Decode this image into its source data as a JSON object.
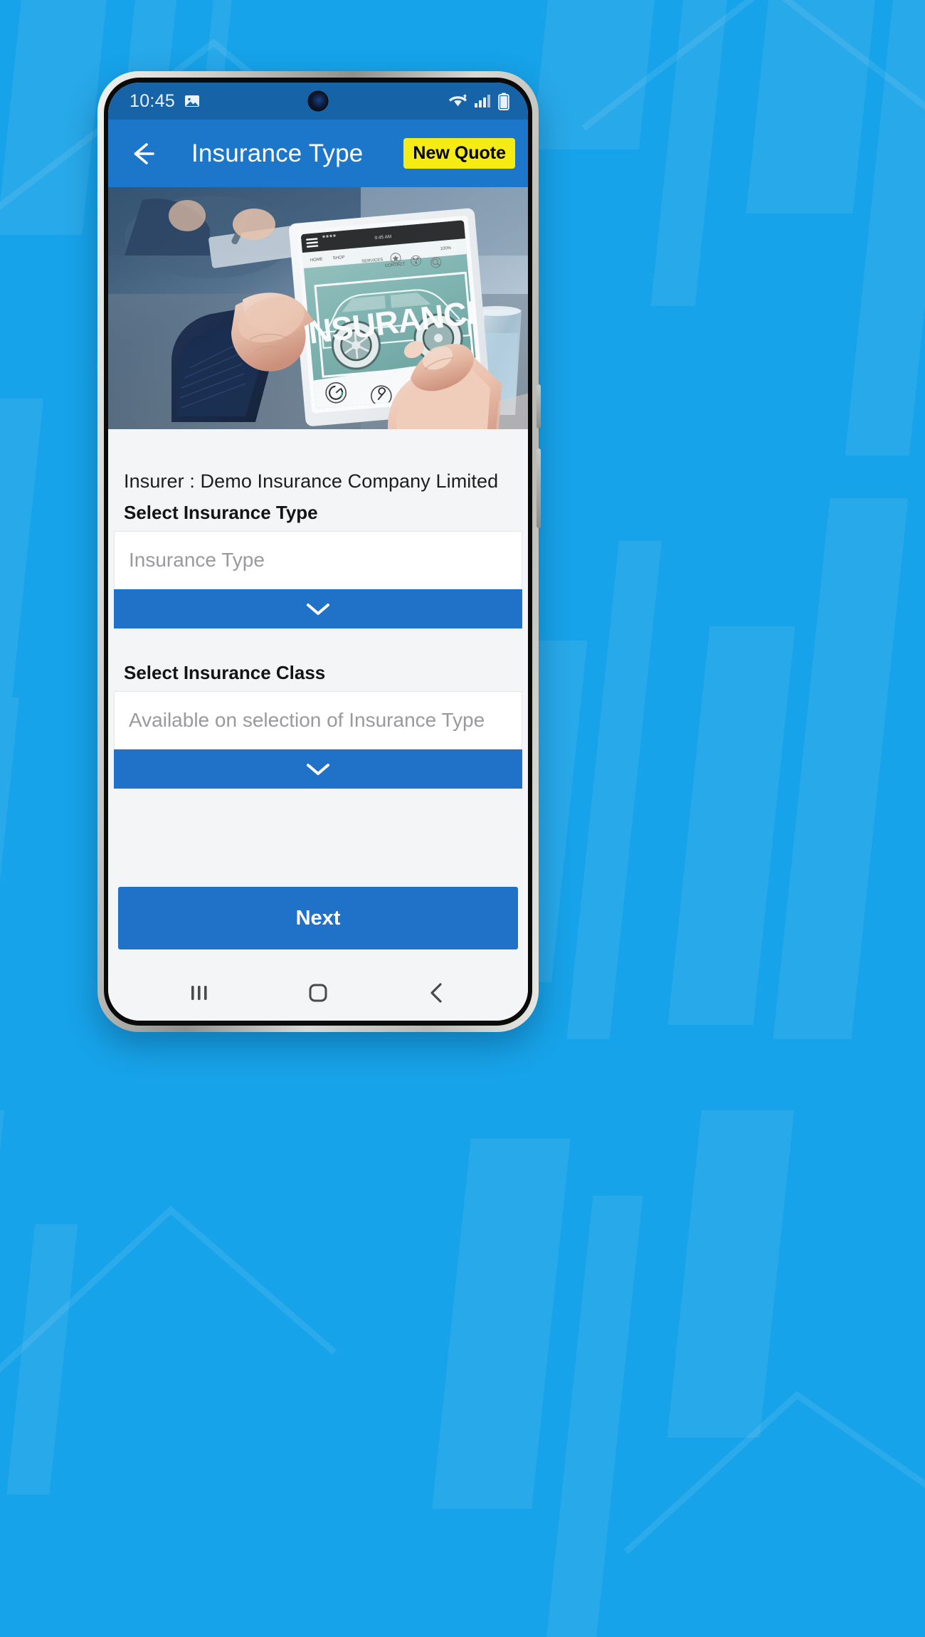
{
  "background": {
    "color": "#17a3e9"
  },
  "device": {
    "frame_color": "#cfcfcb",
    "status_bar": {
      "time": "10:45",
      "left_icons": [
        "image-icon"
      ],
      "right_icons": [
        "wifi-icon",
        "signal-icon",
        "battery-icon"
      ],
      "bg_color": "#1763a8"
    },
    "nav_bar": {
      "recents_label": "recents-icon",
      "home_label": "home-icon",
      "back_label": "back-icon"
    }
  },
  "appbar": {
    "back_icon": "arrow-left-icon",
    "title": "Insurance Type",
    "action_label": "New Quote",
    "bg_color": "#1c77ca",
    "action_color": "#f4ec12"
  },
  "hero": {
    "alt": "Hands holding a tablet displaying a car insurance web page",
    "overlay_word": "INSURANCE"
  },
  "form": {
    "insurer_line": "Insurer : Demo Insurance Company Limited",
    "fields": [
      {
        "label": "Select Insurance Type",
        "placeholder": "Insurance Type",
        "value": "",
        "dropdown_icon": "chevron-down-icon"
      },
      {
        "label": "Select Insurance Class",
        "placeholder": "Available on selection of Insurance Type",
        "value": "",
        "dropdown_icon": "chevron-down-icon"
      }
    ],
    "submit_label": "Next",
    "accent_color": "#2071c8"
  }
}
